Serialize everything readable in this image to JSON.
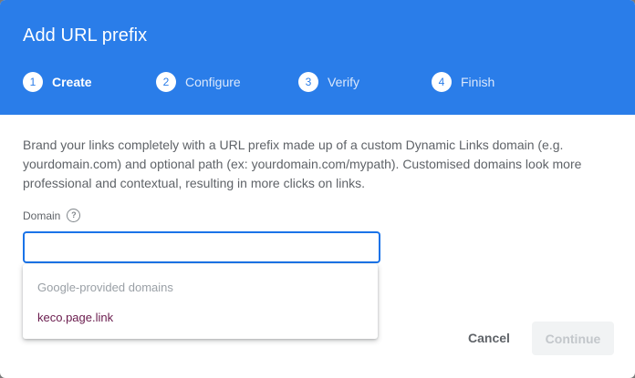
{
  "dialog": {
    "title": "Add URL prefix",
    "steps": [
      {
        "number": "1",
        "label": "Create",
        "state": "active"
      },
      {
        "number": "2",
        "label": "Configure",
        "state": "inactive"
      },
      {
        "number": "3",
        "label": "Verify",
        "state": "inactive"
      },
      {
        "number": "4",
        "label": "Finish",
        "state": "inactive"
      }
    ],
    "description": "Brand your links completely with a URL prefix made up of a custom Dynamic Links domain (e.g. yourdomain.com) and optional path (ex: yourdomain.com/mypath). Customised domains look more professional and contextual, resulting in more clicks on links.",
    "domain_label": "Domain",
    "help_icon": "question-circle-icon",
    "domain_input_value": "",
    "dropdown": {
      "header": "Google-provided domains",
      "options": [
        "keco.page.link"
      ]
    },
    "cancel_label": "Cancel",
    "continue_label": "Continue"
  },
  "colors": {
    "header_blue": "#2a7de9",
    "input_focus_blue": "#1a73e8",
    "option_text": "#6a1b4d"
  }
}
